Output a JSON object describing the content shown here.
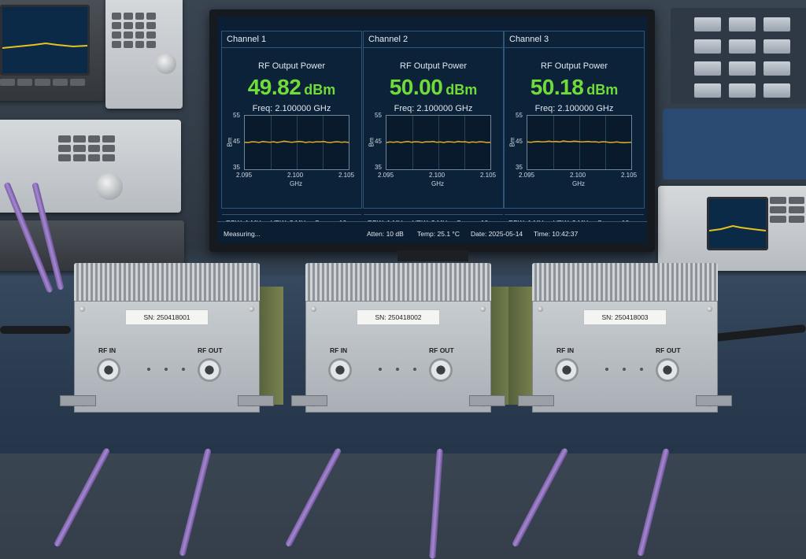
{
  "monitor": {
    "channels": [
      {
        "title": "Channel 1",
        "label": "RF Output Power",
        "value": "49.82",
        "unit": "dBm",
        "freq": "Freq: 2.100000 GHz",
        "trace": [
          45.1,
          45.0,
          45.3,
          45.2,
          45.0,
          45.4,
          45.2,
          45.1,
          45.3,
          45.0,
          45.2,
          45.5,
          45.3,
          45.1,
          45.2,
          45.4,
          45.3,
          45.0,
          45.2,
          45.1,
          45.3,
          45.2,
          45.4,
          45.1,
          45.0,
          45.2,
          45.3,
          45.1,
          45.2,
          45.0
        ]
      },
      {
        "title": "Channel 2",
        "label": "RF Output Power",
        "value": "50.00",
        "unit": "dBm",
        "freq": "Freq: 2.100000 GHz",
        "trace": [
          45.0,
          45.2,
          45.1,
          45.3,
          45.0,
          45.2,
          45.4,
          45.1,
          45.3,
          45.2,
          45.0,
          45.3,
          45.2,
          45.4,
          45.1,
          45.2,
          45.0,
          45.3,
          45.2,
          45.1,
          45.4,
          45.2,
          45.3,
          45.0,
          45.2,
          45.1,
          45.3,
          45.2,
          45.0,
          45.1
        ]
      },
      {
        "title": "Channel 3",
        "label": "RF Output Power",
        "value": "50.18",
        "unit": "dBm",
        "freq": "Freq: 2.100000 GHz",
        "trace": [
          45.2,
          45.1,
          45.3,
          45.4,
          45.2,
          45.3,
          45.5,
          45.3,
          45.4,
          45.2,
          45.6,
          45.4,
          45.3,
          45.5,
          45.4,
          45.2,
          45.3,
          45.4,
          45.2,
          45.3,
          45.1,
          45.3,
          45.2,
          45.0,
          45.1,
          45.2,
          45.0,
          44.9,
          45.0,
          45.1
        ]
      }
    ],
    "plot": {
      "ylabel": "Bm",
      "xlabel": "GHz",
      "y_ticks": [
        "55",
        "45",
        "35"
      ],
      "x_ticks": [
        "2.095",
        "2.100",
        "2.105"
      ],
      "ylim": [
        35,
        55
      ],
      "trace_color": "#e0a91c"
    },
    "settings": {
      "rbw": "RBW: 1 MHz",
      "vbw": "VBW: 3 MHz",
      "sweep": "Sweep: 10 ms"
    },
    "status": {
      "state": "Measuring...",
      "atten": "Atten: 10 dB",
      "temp": "Temp: 25.1 °C",
      "date": "Date: 2025-05-14",
      "time": "Time: 10:42:37"
    },
    "accent_color": "#6fdc3a"
  },
  "amplifiers": [
    {
      "serial": "SN: 250418001",
      "in_label": "RF IN",
      "out_label": "RF OUT"
    },
    {
      "serial": "SN: 250418002",
      "in_label": "RF IN",
      "out_label": "RF OUT"
    },
    {
      "serial": "SN: 250418003",
      "in_label": "RF IN",
      "out_label": "RF OUT"
    }
  ]
}
